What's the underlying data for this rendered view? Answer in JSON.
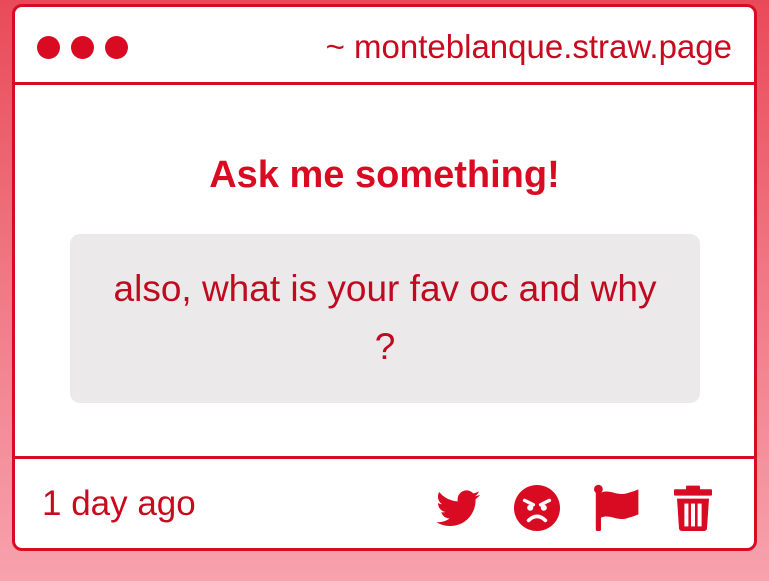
{
  "window": {
    "url": "~ monteblanque.straw.page"
  },
  "main": {
    "heading": "Ask me something!",
    "question": "also, what is your fav oc and why ?"
  },
  "footer": {
    "timestamp": "1 day ago",
    "actions": [
      {
        "icon": "twitter-icon"
      },
      {
        "icon": "angry-face-icon"
      },
      {
        "icon": "flag-icon"
      },
      {
        "icon": "trash-icon"
      }
    ]
  },
  "colors": {
    "accent": "#d80b22",
    "question_bg": "#ece9ea",
    "background_top": "#e94a58",
    "background_bottom": "#f7a2ad"
  }
}
